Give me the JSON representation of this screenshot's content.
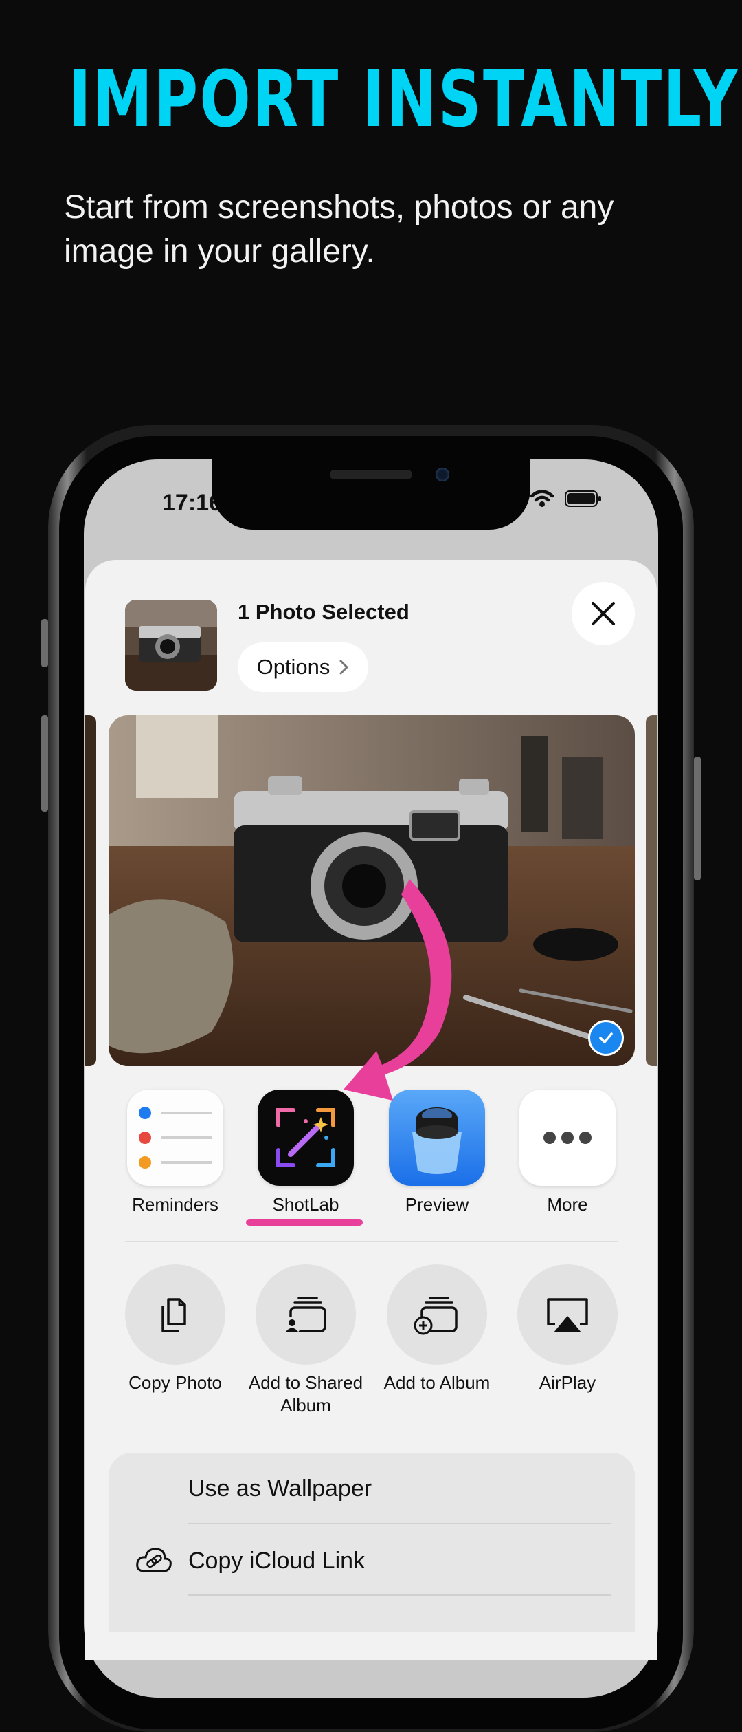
{
  "promo": {
    "headline": "IMPORT INSTANTLY",
    "subheadline": "Start from screenshots, photos or any image in your gallery."
  },
  "status_bar": {
    "time": "17:16"
  },
  "share_sheet": {
    "selection_title": "1 Photo Selected",
    "options_label": "Options",
    "apps": [
      {
        "label": "Reminders",
        "icon": "reminders-icon"
      },
      {
        "label": "ShotLab",
        "icon": "shotlab-icon"
      },
      {
        "label": "Preview",
        "icon": "preview-icon"
      },
      {
        "label": "More",
        "icon": "more-icon"
      }
    ],
    "actions": [
      {
        "label": "Copy Photo",
        "icon": "copy-photo-icon"
      },
      {
        "label": "Add to Shared Album",
        "icon": "shared-album-icon"
      },
      {
        "label": "Add to Album",
        "icon": "add-album-icon"
      },
      {
        "label": "AirPlay",
        "icon": "airplay-icon"
      }
    ],
    "list_items": [
      {
        "label": "Use as Wallpaper"
      },
      {
        "label": "Copy iCloud Link",
        "icon": "icloud-link-icon"
      }
    ]
  },
  "colors": {
    "headline": "#00d4f5",
    "arrow": "#e8409a",
    "background": "#0b0b0b"
  }
}
